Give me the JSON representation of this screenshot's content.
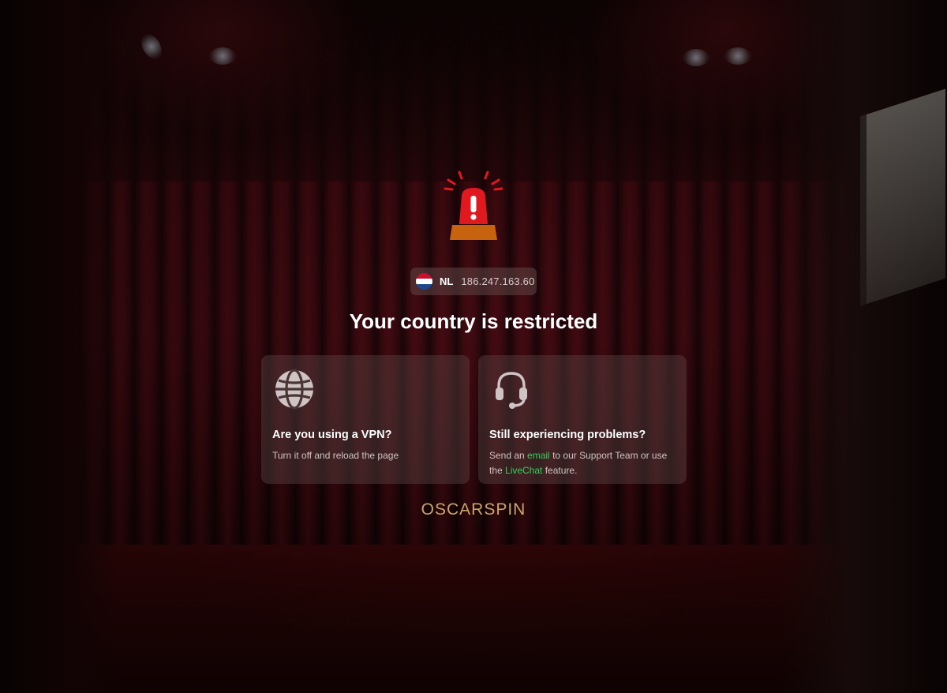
{
  "location": {
    "country_code": "NL",
    "ip_address": "186.247.163.60",
    "flag_colors": [
      "#c8102e",
      "#ffffff",
      "#21468b"
    ]
  },
  "headline": "Your country is restricted",
  "cards": {
    "vpn": {
      "icon": "globe-icon",
      "title": "Are you using a VPN?",
      "text": "Turn it off and reload the page"
    },
    "support": {
      "icon": "headset-icon",
      "title": "Still experiencing problems?",
      "text_before_email": "Send an ",
      "email_link": "email",
      "text_middle": " to our Support Team or use the ",
      "livechat_link": "LiveChat",
      "text_after": " feature."
    }
  },
  "brand": {
    "logo_text": "OSCARSPIN",
    "logo_color": "#c9a56d"
  },
  "colors": {
    "link_green": "#33d05a",
    "siren_red": "#e0191f",
    "siren_base": "#c7620e"
  }
}
